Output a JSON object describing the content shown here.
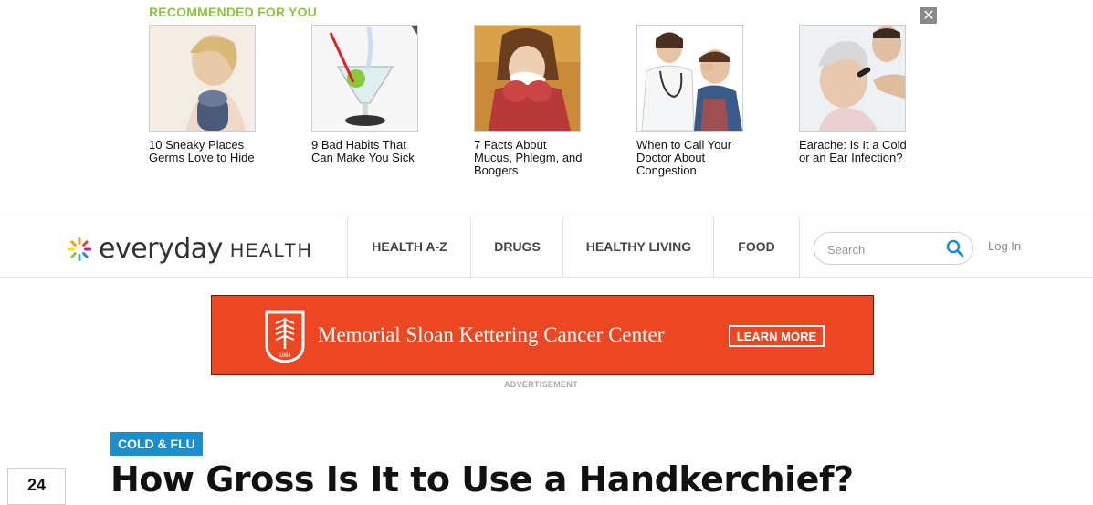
{
  "recommended": {
    "title": "RECOMMENDED FOR YOU",
    "close_glyph": "✕",
    "items": [
      {
        "caption": "10 Sneaky Places Germs Love to Hide",
        "icon": "woman-microphone-photo"
      },
      {
        "caption": "9 Bad Habits That Can Make You Sick",
        "icon": "cocktail-glass-photo"
      },
      {
        "caption": "7 Facts About Mucus, Phlegm, and Boogers",
        "icon": "woman-sneezing-photo"
      },
      {
        "caption": "When to Call Your Doctor About Congestion",
        "icon": "doctor-patient-photo"
      },
      {
        "caption": "Earache: Is It a Cold or an Ear Infection?",
        "icon": "ear-exam-photo"
      }
    ]
  },
  "header": {
    "logo_word": "everyday",
    "logo_health": "HEALTH",
    "nav": [
      {
        "label": "HEALTH A-Z"
      },
      {
        "label": "DRUGS"
      },
      {
        "label": "HEALTHY LIVING"
      },
      {
        "label": "FOOD"
      }
    ],
    "search": {
      "placeholder": "Search",
      "value": ""
    },
    "login_label": "Log In"
  },
  "ad": {
    "advertiser": "Memorial Sloan Kettering Cancer Center",
    "cta": "LEARN MORE",
    "logo_year": "1884",
    "caption": "ADVERTISEMENT",
    "background_color": "#ed4622"
  },
  "article": {
    "category": "COLD & FLU",
    "title": "How Gross Is It to Use a Handkerchief?",
    "share_count": "24"
  },
  "colors": {
    "accent_green": "#8dc63f",
    "accent_blue": "#1b8ecf"
  }
}
